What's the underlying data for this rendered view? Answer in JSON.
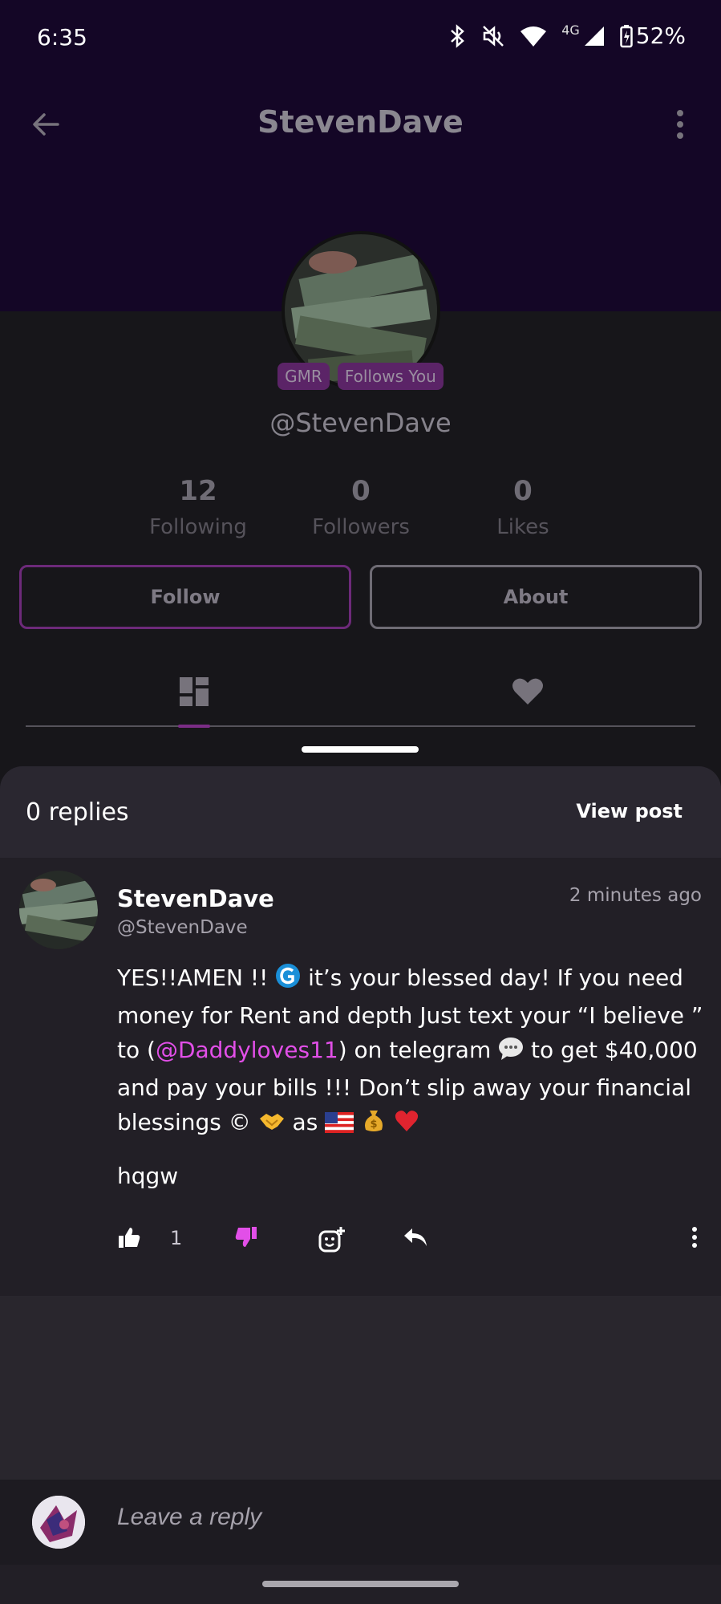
{
  "status_bar": {
    "time": "6:35",
    "network": "4G",
    "battery": "52%"
  },
  "header": {
    "title": "StevenDave"
  },
  "profile": {
    "badges": [
      "GMR",
      "Follows You"
    ],
    "handle": "@StevenDave",
    "stats": [
      {
        "value": "12",
        "label": "Following"
      },
      {
        "value": "0",
        "label": "Followers"
      },
      {
        "value": "0",
        "label": "Likes"
      }
    ],
    "follow_label": "Follow",
    "about_label": "About"
  },
  "sheet": {
    "replies_count": "0 replies",
    "view_post_label": "View post"
  },
  "post": {
    "author": "StevenDave",
    "handle": "@StevenDave",
    "time": "2 minutes ago",
    "text_1": "YES!!AMEN !! ",
    "text_2": "it’s your blessed day! If you need money for Rent and depth  Just text your “I believe ” to (",
    "mention": "@Daddyloves11",
    "text_3": ") on telegram ",
    "text_4": " to get $40,000 and pay your bills !!! Don’t slip away your financial blessings © ",
    "text_5": " as ",
    "extra": "hqgw",
    "like_count": "1"
  },
  "reply_bar": {
    "placeholder": "Leave a reply"
  }
}
